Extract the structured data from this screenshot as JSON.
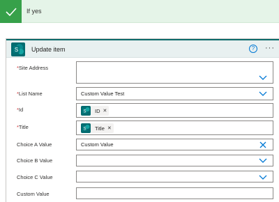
{
  "branch": {
    "title": "If yes"
  },
  "card": {
    "title": "Update item"
  },
  "fields": {
    "site_address": {
      "required": "*",
      "label": "Site Address",
      "value": ""
    },
    "list_name": {
      "required": "*",
      "label": "List Name",
      "value": "Custom Value Test"
    },
    "id": {
      "required": "*",
      "label": "Id",
      "token": "ID"
    },
    "title": {
      "required": "*",
      "label": "Title",
      "token": "Title"
    },
    "choice_a": {
      "label": "Choice A Value",
      "value": "Custom Value"
    },
    "choice_b": {
      "label": "Choice B Value",
      "value": ""
    },
    "choice_c": {
      "label": "Choice C Value",
      "value": ""
    },
    "custom_value": {
      "label": "Custom Value",
      "value": ""
    }
  },
  "colors": {
    "accent": "#0078d4",
    "success": "#37a14a",
    "sharepoint": "#036c70"
  },
  "icons": [
    "checkmark-icon",
    "sharepoint-icon",
    "help-icon",
    "more-icon",
    "chevron-down-icon",
    "clear-icon",
    "remove-token-icon"
  ]
}
